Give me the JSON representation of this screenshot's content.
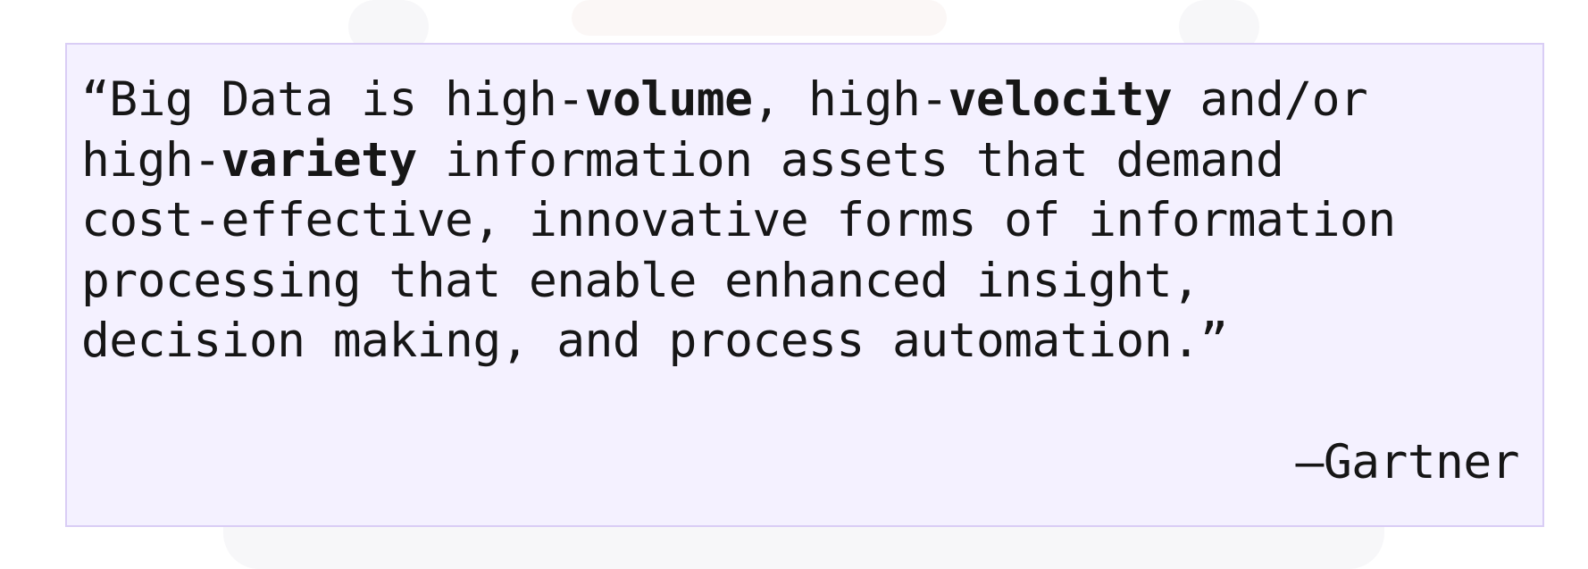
{
  "quote": {
    "lines": [
      [
        {
          "text": "“Big Data is high-",
          "bold": false
        },
        {
          "text": "volume",
          "bold": true
        },
        {
          "text": ", high-",
          "bold": false
        },
        {
          "text": "velocity",
          "bold": true
        },
        {
          "text": " and/or",
          "bold": false
        }
      ],
      [
        {
          "text": "high-",
          "bold": false
        },
        {
          "text": "variety",
          "bold": true
        },
        {
          "text": " information assets that demand",
          "bold": false
        }
      ],
      [
        {
          "text": "cost-effective, innovative forms of information",
          "bold": false
        }
      ],
      [
        {
          "text": "processing that enable enhanced insight,",
          "bold": false
        }
      ],
      [
        {
          "text": "decision making, and process automation.”",
          "bold": false
        }
      ]
    ],
    "attribution": "—Gartner"
  },
  "colors": {
    "card_background": "#f4f1ff",
    "card_border": "#d9cdf5",
    "text": "#161616"
  }
}
